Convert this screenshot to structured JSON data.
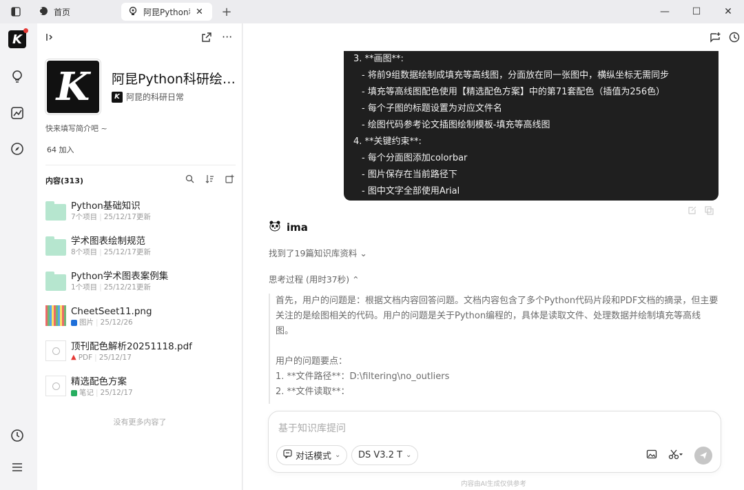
{
  "titlebar": {
    "tabs": [
      {
        "label": "首页",
        "icon": "home-logo-icon"
      },
      {
        "label": "阿昆Python科研绘图",
        "icon": "bulb-icon",
        "active": true
      }
    ],
    "new_tab": "+",
    "window": {
      "minimize": "—",
      "maximize": "☐",
      "close": "✕"
    }
  },
  "rail": {
    "logo": "K",
    "items": [
      "bulb-icon",
      "chart-icon",
      "compass-icon"
    ],
    "bottom": [
      "history-icon",
      "menu-icon"
    ]
  },
  "panel": {
    "cover_letter": "K",
    "title": "阿昆Python科研绘图...",
    "owner_logo": "K",
    "owner": "阿昆的科研日常",
    "intro": "快来填写简介吧 ~",
    "joined": "64 加入",
    "content_label": "内容(313)",
    "files": [
      {
        "name": "Python基础知识",
        "kind": "folder",
        "meta1": "7个项目",
        "meta2": "25/12/17更新"
      },
      {
        "name": "学术图表绘制规范",
        "kind": "folder",
        "meta1": "8个项目",
        "meta2": "25/12/17更新"
      },
      {
        "name": "Python学术图表案例集",
        "kind": "folder",
        "meta1": "1个项目",
        "meta2": "25/12/21更新"
      },
      {
        "name": "CheetSeet11.png",
        "kind": "image",
        "meta1": "图片",
        "meta2": "25/12/26",
        "tag_color": "#1e6fd9"
      },
      {
        "name": "顶刊配色解析20251118.pdf",
        "kind": "pdf",
        "meta1": "PDF",
        "meta2": "25/12/17",
        "tag_color": "#e53935"
      },
      {
        "name": "精选配色方案",
        "kind": "note",
        "meta1": "笔记",
        "meta2": "25/12/17",
        "tag_color": "#27ae60"
      }
    ],
    "no_more": "没有更多内容了"
  },
  "chat": {
    "prompt_lines": [
      {
        "text": "3. **画图**:",
        "sub": false
      },
      {
        "text": "- 将前9组数据绘制成填充等高线图，分面放在同一张图中，横纵坐标无需同步",
        "sub": true
      },
      {
        "text": "- 填充等高线图配色使用【精选配色方案】中的第71套配色（插值为256色）",
        "sub": true
      },
      {
        "text": "- 每个子图的标题设置为对应文件名",
        "sub": true
      },
      {
        "text": "- 绘图代码参考论文插图绘制模板-填充等高线图",
        "sub": true
      },
      {
        "text": "4. **关键约束**:",
        "sub": false
      },
      {
        "text": "- 每个分面图添加colorbar",
        "sub": true
      },
      {
        "text": "- 图片保存在当前路径下",
        "sub": true
      },
      {
        "text": "- 图中文字全部使用Arial",
        "sub": true
      }
    ],
    "assistant_name": "ima",
    "found": "找到了19篇知识库资料",
    "thinking": "思考过程 (用时37秒)",
    "think_lines": [
      "首先，用户的问题是：根据文档内容回答问题。文档内容包含了多个Python代码片段和PDF文档的摘录，但主要",
      "关注的是绘图相关的代码。用户的问题是关于Python编程的，具体是读取文件、处理数据并绘制填充等高线",
      "图。",
      "",
      "用户的问题要点：",
      "1. **文件路径**：D:\\filtering\\no_outliers",
      "2. **文件读取**：",
      "   ..."
    ],
    "input_placeholder": "基于知识库提问",
    "mode": "对话模式",
    "model": "DS V3.2 T",
    "footnote": "内容由AI生成仅供参考"
  }
}
